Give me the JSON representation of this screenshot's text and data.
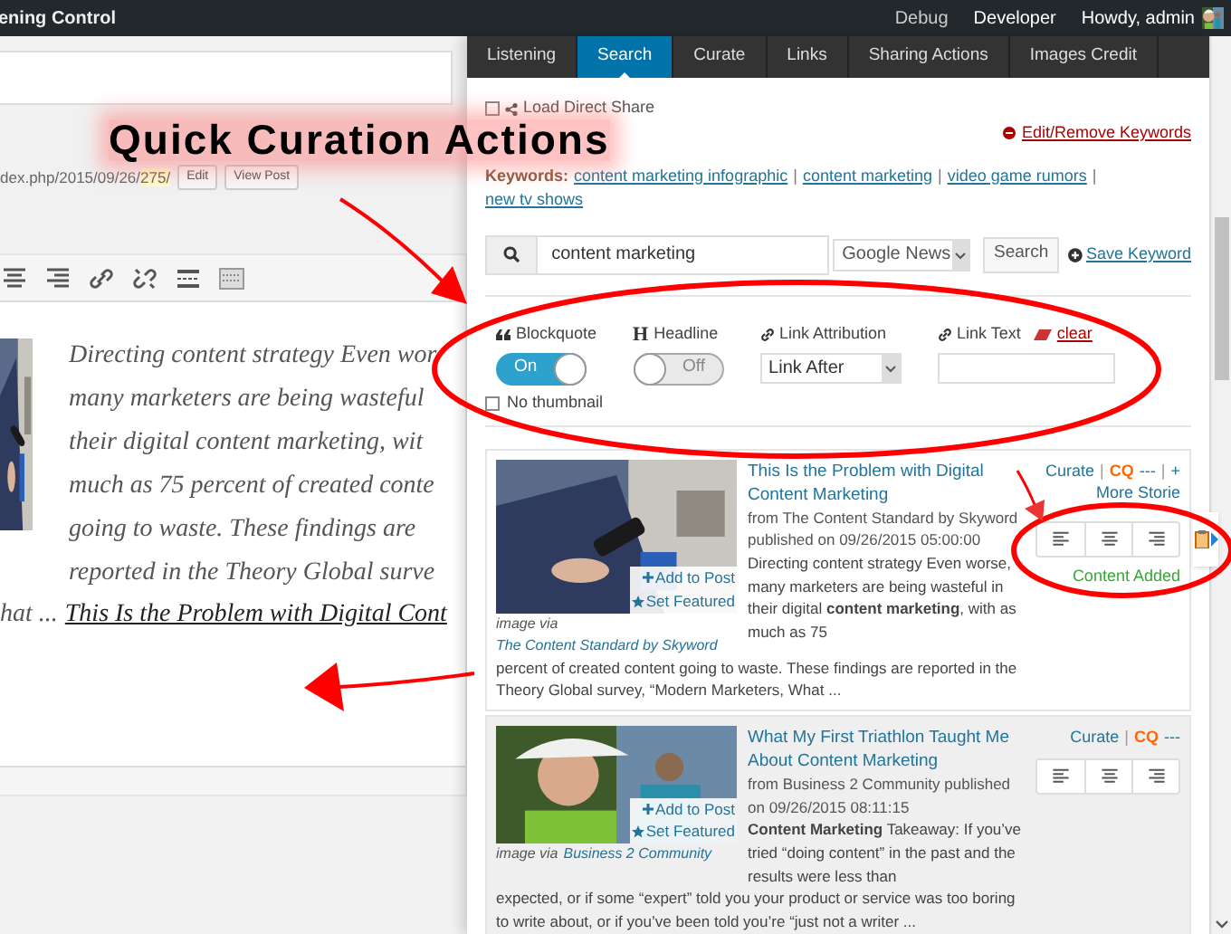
{
  "admin_bar": {
    "site_title": "ening Control",
    "links": [
      "Debug",
      "Developer"
    ],
    "greeting": "Howdy, admin"
  },
  "editor": {
    "permalink": "dex.php/2015/09/26/",
    "permalink_slug": "275/",
    "buttons": [
      "Edit",
      "View Post"
    ],
    "toolbar": [
      {
        "kind": "align-center"
      },
      {
        "kind": "align-right"
      },
      {
        "kind": "link"
      },
      {
        "kind": "unlink"
      },
      {
        "kind": "more"
      },
      {
        "kind": "toolbar-toggle"
      }
    ],
    "lines": [
      "Directing content strategy Even wor",
      "many marketers are being wasteful",
      "their digital content marketing, wit",
      "much as 75 percent of created conte",
      "going to waste. These findings are",
      "reported in the Theory Global surve"
    ],
    "last_line": {
      "text": "hat ...",
      "link": "This Is the Problem with Digital Cont"
    }
  },
  "annotation": {
    "caption": "Quick Curation Actions"
  },
  "panel": {
    "tabs": [
      {
        "label": "Listening",
        "selected": false
      },
      {
        "label": "Search",
        "selected": true
      },
      {
        "label": "Curate",
        "selected": false
      },
      {
        "label": "Links",
        "selected": false
      },
      {
        "label": "Sharing Actions",
        "selected": false
      },
      {
        "label": "Images Credit",
        "selected": false
      }
    ],
    "load_direct_share": {
      "label": "Load Direct Share",
      "checked": false
    },
    "edit_keywords": "Edit/Remove Keywords",
    "keywords_label": "Keywords:",
    "keywords": [
      "content marketing infographic",
      "content marketing",
      "video game rumors",
      "new tv shows"
    ],
    "separator": "|",
    "search": {
      "value": "content marketing",
      "source": "Google News",
      "button": "Search",
      "save": "Save Keyword"
    },
    "options": [
      {
        "kind": "toggle",
        "label": "Blockquote",
        "on": true,
        "text": "On"
      },
      {
        "kind": "toggle",
        "glyph": "H",
        "label": "Headline",
        "on": false,
        "text": "Off"
      },
      {
        "kind": "select",
        "label": "Link Attribution",
        "value": "Link After"
      },
      {
        "kind": "text",
        "label": "Link Text",
        "clear": "clear"
      }
    ],
    "no_thumbnail": {
      "label": "No thumbnail",
      "checked": false
    },
    "results": [
      {
        "title": "This Is the Problem with Digital Content Marketing",
        "source": "from The Content Standard by Skyword published on 09/26/2015 05:00:00",
        "snippet": [
          "Directing content strategy Even worse, many marketers are being wasteful in their digital **content marketing**, with as much as 75",
          "percent of created content going to waste. These findings are reported in the Theory Global survey, “Modern Marketers, What ..."
        ],
        "add": "Add to Post",
        "featured": "Set Featured",
        "credit_prefix": "image via",
        "credit": "The Content Standard by Skyword",
        "curate": "Curate",
        "cq": "CQ",
        "cq_menu": "---",
        "more_icon": "+",
        "more": "More Storie",
        "status": "Content Added",
        "popup": true,
        "highlighted": false
      },
      {
        "title": "What My First Triathlon Taught Me About Content Marketing",
        "source": "from Business 2 Community published on 09/26/2015 08:11:15",
        "snippet": [
          "**Content Marketing** Takeaway: If you’ve tried “doing content” in the past and the results were less than",
          "expected, or if some “expert” told you your product or service was too boring to write about, or if you’ve been told you’re “just not a writer ..."
        ],
        "add": "Add to Post",
        "featured": "Set Featured",
        "credit_prefix": "image via",
        "credit": "Business 2 Community",
        "curate": "Curate",
        "cq": "CQ",
        "cq_menu": "---",
        "popup": false,
        "highlighted": true
      }
    ]
  }
}
